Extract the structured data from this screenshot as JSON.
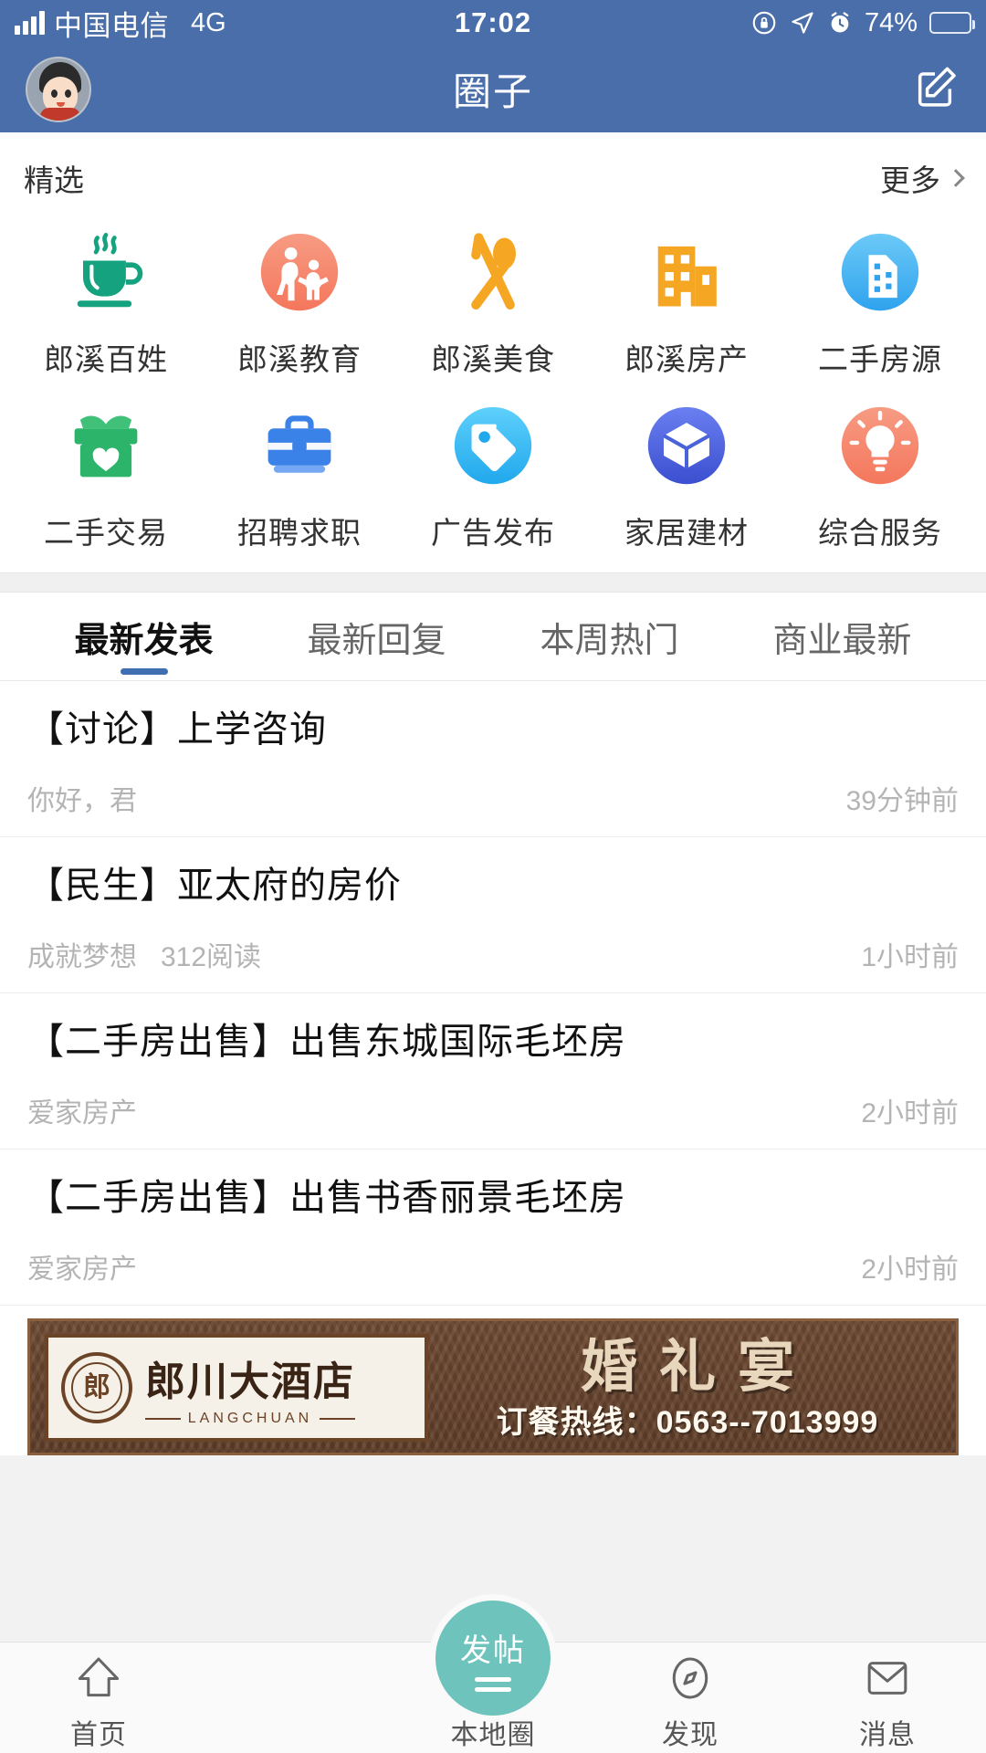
{
  "status_bar": {
    "carrier": "中国电信",
    "network": "4G",
    "time": "17:02",
    "battery_percent": "74%",
    "icons": [
      "signal-icon",
      "rotation-lock-icon",
      "location-arrow-icon",
      "alarm-clock-icon",
      "battery-icon"
    ]
  },
  "nav_bar": {
    "title": "圈子",
    "avatar": "user-avatar",
    "compose": "compose-icon"
  },
  "categories": {
    "header_label": "精选",
    "more_label": "更多",
    "items": [
      {
        "label": "郎溪百姓",
        "icon": "coffee-cup-icon",
        "color": "#15a37f",
        "shape": "plain"
      },
      {
        "label": "郎溪教育",
        "icon": "education-icon",
        "color": "#f4866a",
        "shape": "circle"
      },
      {
        "label": "郎溪美食",
        "icon": "food-icon",
        "color": "#f5a623",
        "shape": "plain"
      },
      {
        "label": "郎溪房产",
        "icon": "building-icon",
        "color": "#f5a623",
        "shape": "plain"
      },
      {
        "label": "二手房源",
        "icon": "house-icon",
        "color": "#4bb4f5",
        "shape": "circle"
      },
      {
        "label": "二手交易",
        "icon": "trade-box-icon",
        "color": "#2cb56a",
        "shape": "plain"
      },
      {
        "label": "招聘求职",
        "icon": "briefcase-icon",
        "color": "#3b82e8",
        "shape": "plain"
      },
      {
        "label": "广告发布",
        "icon": "tag-icon",
        "color": "#36b8f0",
        "shape": "circle"
      },
      {
        "label": "家居建材",
        "icon": "package-box-icon",
        "color": "#4a63d8",
        "shape": "circle"
      },
      {
        "label": "综合服务",
        "icon": "lightbulb-icon",
        "color": "#f4866a",
        "shape": "circle"
      }
    ]
  },
  "tabs": [
    {
      "label": "最新发表",
      "active": true
    },
    {
      "label": "最新回复",
      "active": false
    },
    {
      "label": "本周热门",
      "active": false
    },
    {
      "label": "商业最新",
      "active": false
    }
  ],
  "posts": [
    {
      "title": "【讨论】上学咨询",
      "author": "你好，君",
      "views": "",
      "time": "39分钟前"
    },
    {
      "title": "【民生】亚太府的房价",
      "author": "成就梦想",
      "views": "312阅读",
      "time": "1小时前"
    },
    {
      "title": "【二手房出售】出售东城国际毛坯房",
      "author": "爱家房产",
      "views": "",
      "time": "2小时前"
    },
    {
      "title": "【二手房出售】出售书香丽景毛坯房",
      "author": "爱家房产",
      "views": "",
      "time": "2小时前"
    }
  ],
  "ad_banner": {
    "hotel_name": "郎川大酒店",
    "hotel_pinyin": "LANGCHUAN",
    "headline": "婚礼宴",
    "hotline": "订餐热线：0563--7013999",
    "seal_text": "郎"
  },
  "bottom_nav": {
    "items": [
      {
        "label": "首页",
        "icon": "home-arrow-icon",
        "active": false
      },
      {
        "label": "本地圈",
        "icon": "aperture-icon",
        "active": false
      },
      {
        "label": "发现",
        "icon": "compass-icon",
        "active": false
      },
      {
        "label": "消息",
        "icon": "envelope-icon",
        "active": false
      }
    ],
    "fab": {
      "label": "发帖",
      "icon": "post-fab-icon",
      "color": "#6ec4bd"
    }
  },
  "theme": {
    "nav_blue": "#4a6ea9",
    "tab_underline": "#3f6fb0",
    "fab_teal": "#6ec4bd",
    "muted_text": "#b4b4b4"
  }
}
